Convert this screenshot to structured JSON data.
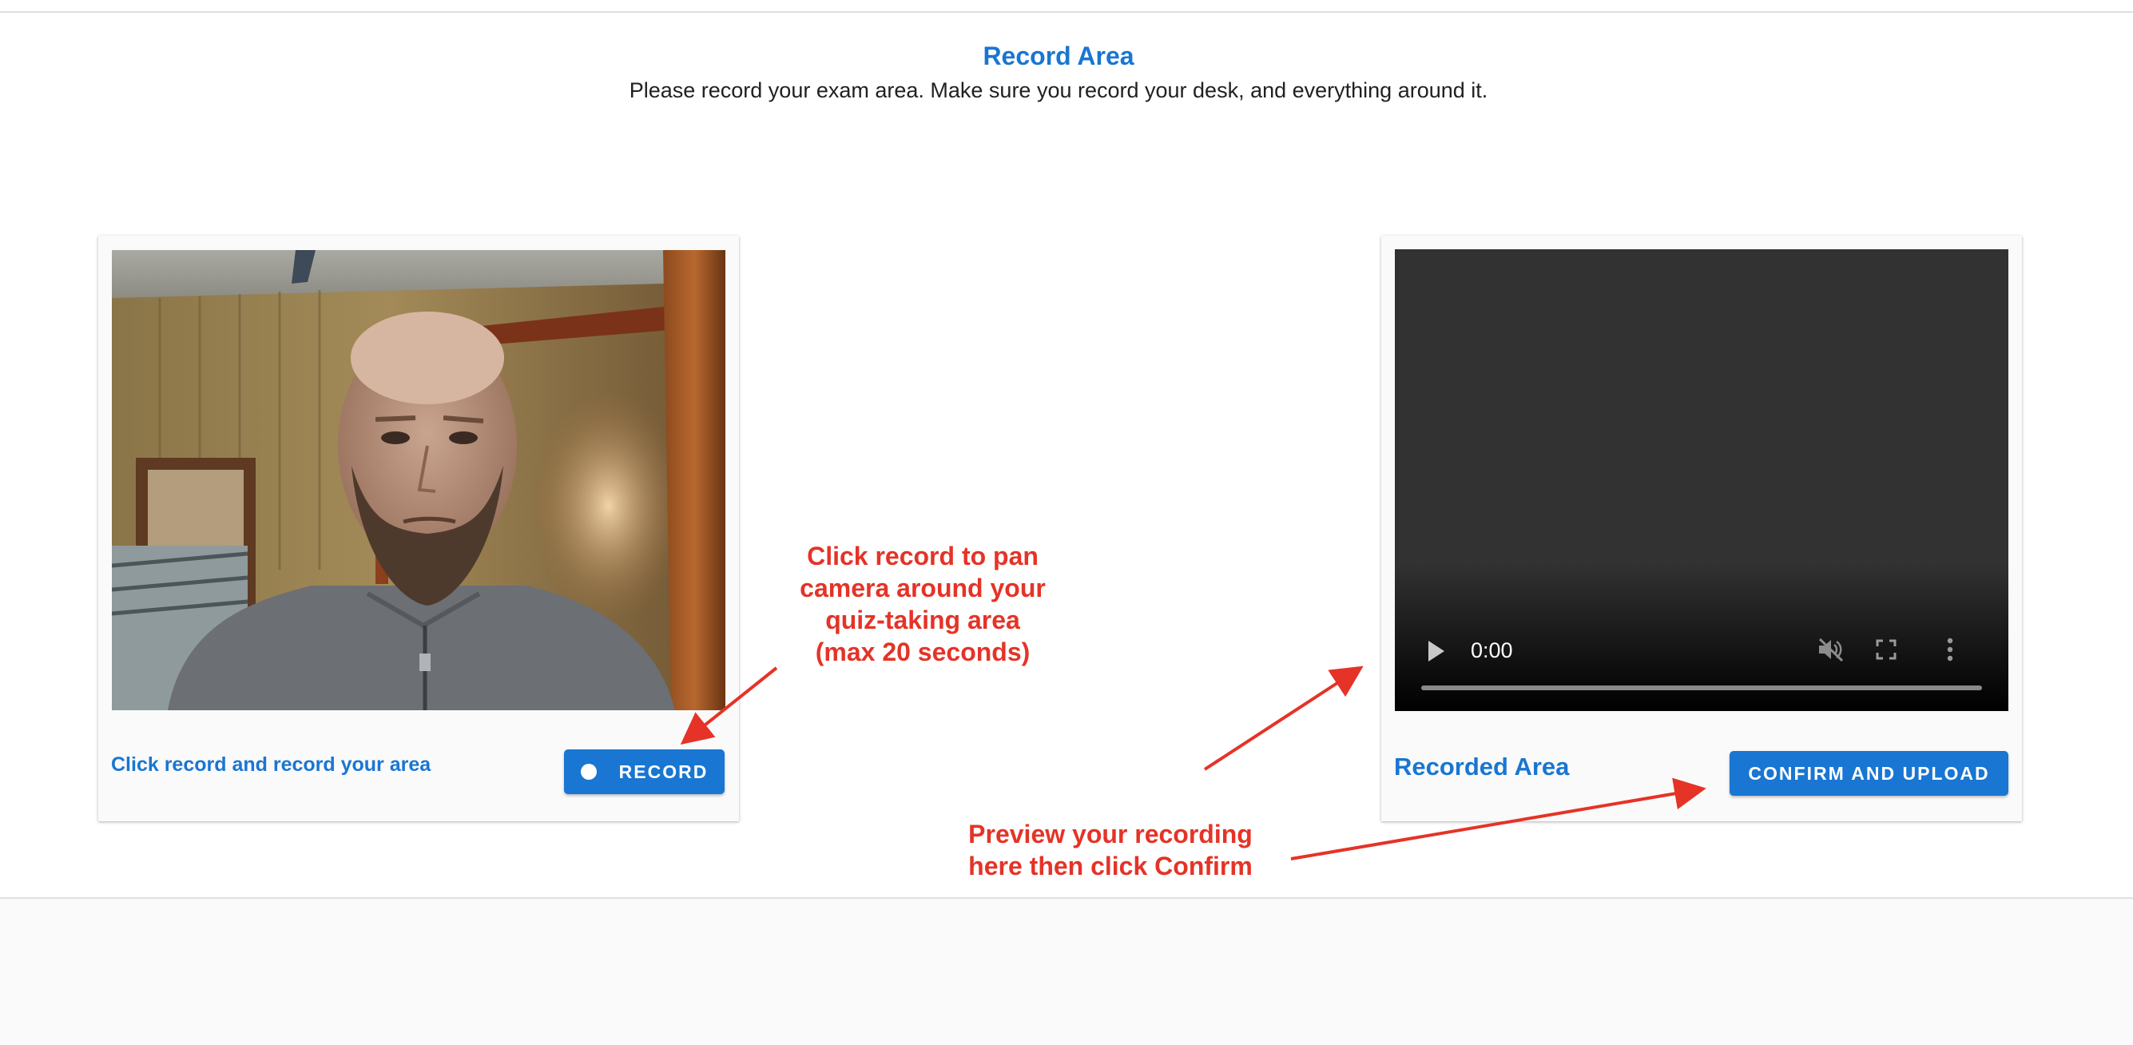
{
  "header": {
    "title": "Record Area",
    "subtitle": "Please record your exam area. Make sure you record your desk, and everything around it."
  },
  "left_panel": {
    "label": "Click record and record your area",
    "record_button_label": "RECORD"
  },
  "right_panel": {
    "label": "Recorded Area",
    "confirm_button_label": "CONFIRM AND UPLOAD",
    "video": {
      "time": "0:00",
      "progress": 0,
      "muted": true
    }
  },
  "annotations": {
    "record_hint": [
      "Click record to pan",
      "camera around your",
      "quiz-taking area",
      "(max 20 seconds)"
    ],
    "preview_hint": [
      "Preview your recording",
      "here then click Confirm"
    ]
  },
  "colors": {
    "accent": "#1976d2",
    "annotation": "#e53327",
    "video_background": "#323232",
    "card_background": "#fafafa"
  },
  "icons": {
    "record_dot": "record-dot-icon",
    "play": "play-icon",
    "mute": "volume-off-icon",
    "fullscreen": "fullscreen-icon",
    "more": "more-vert-icon"
  }
}
